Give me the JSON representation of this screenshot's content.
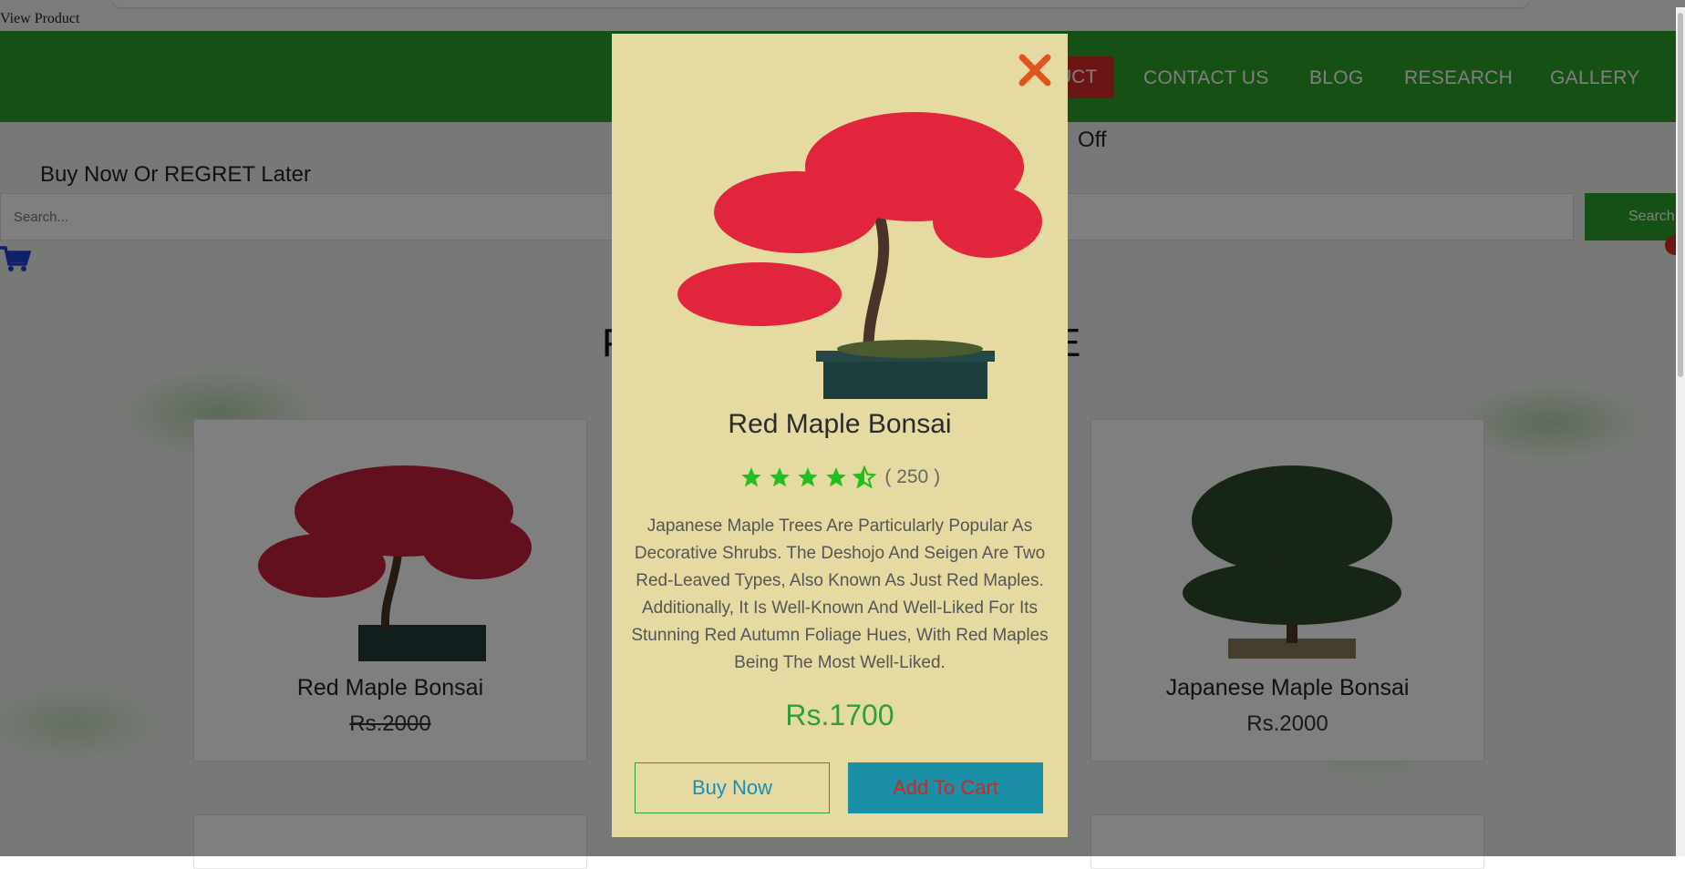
{
  "browser": {
    "tab_label": "View Product"
  },
  "nav": {
    "items": [
      "CONTACT US",
      "BLOG",
      "RESEARCH",
      "GALLERY"
    ],
    "active_partial": "UCT"
  },
  "banner": {
    "tagline": "Buy Now Or REGRET Later",
    "offer_partial": "Off"
  },
  "search": {
    "placeholder": "Search...",
    "button": "Search"
  },
  "section": {
    "title_left": "P",
    "title_right": "E"
  },
  "products": [
    {
      "name": "Red Maple Bonsai",
      "price": "Rs.2000",
      "strike": true
    },
    {
      "name": "Japanese Maple Bonsai",
      "price": "Rs.2000",
      "strike": false
    }
  ],
  "modal": {
    "title": "Red Maple Bonsai",
    "rating": 4.5,
    "review_count": "( 250 )",
    "description": "Japanese Maple Trees Are Particularly Popular As Decorative Shrubs. The Deshojo And Seigen Are Two Red-Leaved Types, Also Known As Just Red Maples. Additionally, It Is Well-Known And Well-Liked For Its Stunning Red Autumn Foliage Hues, With  Red Maples Being The Most Well-Liked.",
    "price": "Rs.1700",
    "buy_label": "Buy Now",
    "cart_label": "Add To Cart"
  },
  "colors": {
    "nav": "#2ea02b",
    "active": "#d62b2b",
    "modal_bg": "#e5dba2",
    "price": "#2e9e3c",
    "close": "#e2541f",
    "star": "#22c01e"
  },
  "icons": [
    "cart-icon",
    "close-icon",
    "star-icon",
    "star-half-icon"
  ]
}
